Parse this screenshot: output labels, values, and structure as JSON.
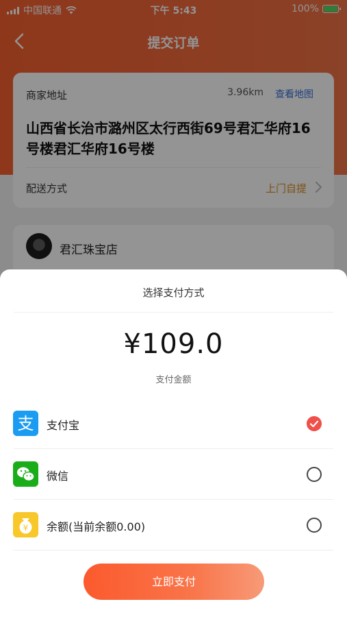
{
  "status_bar": {
    "carrier": "中国联通",
    "time": "下午 5:43",
    "battery": "100%"
  },
  "nav": {
    "title": "提交订单"
  },
  "merchant": {
    "label": "商家地址",
    "distance": "3.96km",
    "map_link": "查看地图",
    "address": "山西省长治市潞州区太行西街69号君汇华府16号楼君汇华府16号楼",
    "delivery_label": "配送方式",
    "delivery_value": "上门自提"
  },
  "shop": {
    "name": "君汇珠宝店"
  },
  "payment_sheet": {
    "title": "选择支付方式",
    "amount": "¥109.0",
    "amount_label": "支付金额",
    "methods": [
      {
        "label": "支付宝",
        "icon": "alipay-icon",
        "selected": true
      },
      {
        "label": "微信",
        "icon": "wechat-icon",
        "selected": false
      },
      {
        "label": "余额(当前余额0.00)",
        "icon": "balance-icon",
        "selected": false
      }
    ],
    "pay_button": "立即支付"
  },
  "colors": {
    "brand": "#f5602f",
    "link": "#3a6fd8",
    "accent_text": "#d88a24",
    "selected": "#f0504a"
  }
}
